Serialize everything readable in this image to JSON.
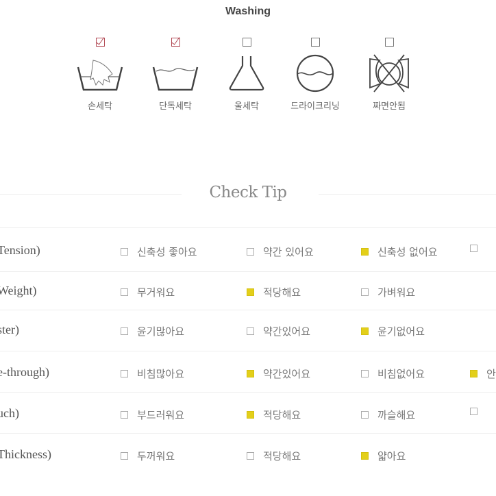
{
  "washing": {
    "title": "Washing",
    "items": [
      {
        "label": "손세탁",
        "checked": true,
        "icon": "hand-wash-icon"
      },
      {
        "label": "단독세탁",
        "checked": true,
        "icon": "wash-tub-icon"
      },
      {
        "label": "울세탁",
        "checked": false,
        "icon": "wool-wash-flask-icon"
      },
      {
        "label": "드라이크리닝",
        "checked": false,
        "icon": "dry-clean-icon"
      },
      {
        "label": "짜면안됨",
        "checked": false,
        "icon": "do-not-wring-icon"
      }
    ],
    "check_color": "#b24a55"
  },
  "check_tip": {
    "title": "Check Tip",
    "selected_color": "#e3cf1a",
    "rows": [
      {
        "label": "Tension)",
        "options": [
          {
            "text": "신축성 좋아요",
            "checked": false
          },
          {
            "text": "약간 있어요",
            "checked": false
          },
          {
            "text": "신축성 없어요",
            "checked": true
          },
          {
            "text": "",
            "checked": false
          }
        ]
      },
      {
        "label": "Weight)",
        "options": [
          {
            "text": "무거워요",
            "checked": false
          },
          {
            "text": "적당해요",
            "checked": true
          },
          {
            "text": "가벼워요",
            "checked": false
          }
        ]
      },
      {
        "label": "ster)",
        "options": [
          {
            "text": "윤기많아요",
            "checked": false
          },
          {
            "text": "약간있어요",
            "checked": false
          },
          {
            "text": "윤기없어요",
            "checked": true
          }
        ]
      },
      {
        "label": "e-through)",
        "options": [
          {
            "text": "비침많아요",
            "checked": false
          },
          {
            "text": "약간있어요",
            "checked": true
          },
          {
            "text": "비침없어요",
            "checked": false
          },
          {
            "text": "안",
            "checked": true
          }
        ]
      },
      {
        "label": "uch)",
        "options": [
          {
            "text": "부드러워요",
            "checked": false
          },
          {
            "text": "적당해요",
            "checked": true
          },
          {
            "text": "까슬해요",
            "checked": false
          },
          {
            "text": "",
            "checked": false
          }
        ]
      },
      {
        "label": "Thickness)",
        "options": [
          {
            "text": "두꺼워요",
            "checked": false
          },
          {
            "text": "적당해요",
            "checked": false
          },
          {
            "text": "얇아요",
            "checked": true
          }
        ]
      }
    ]
  }
}
